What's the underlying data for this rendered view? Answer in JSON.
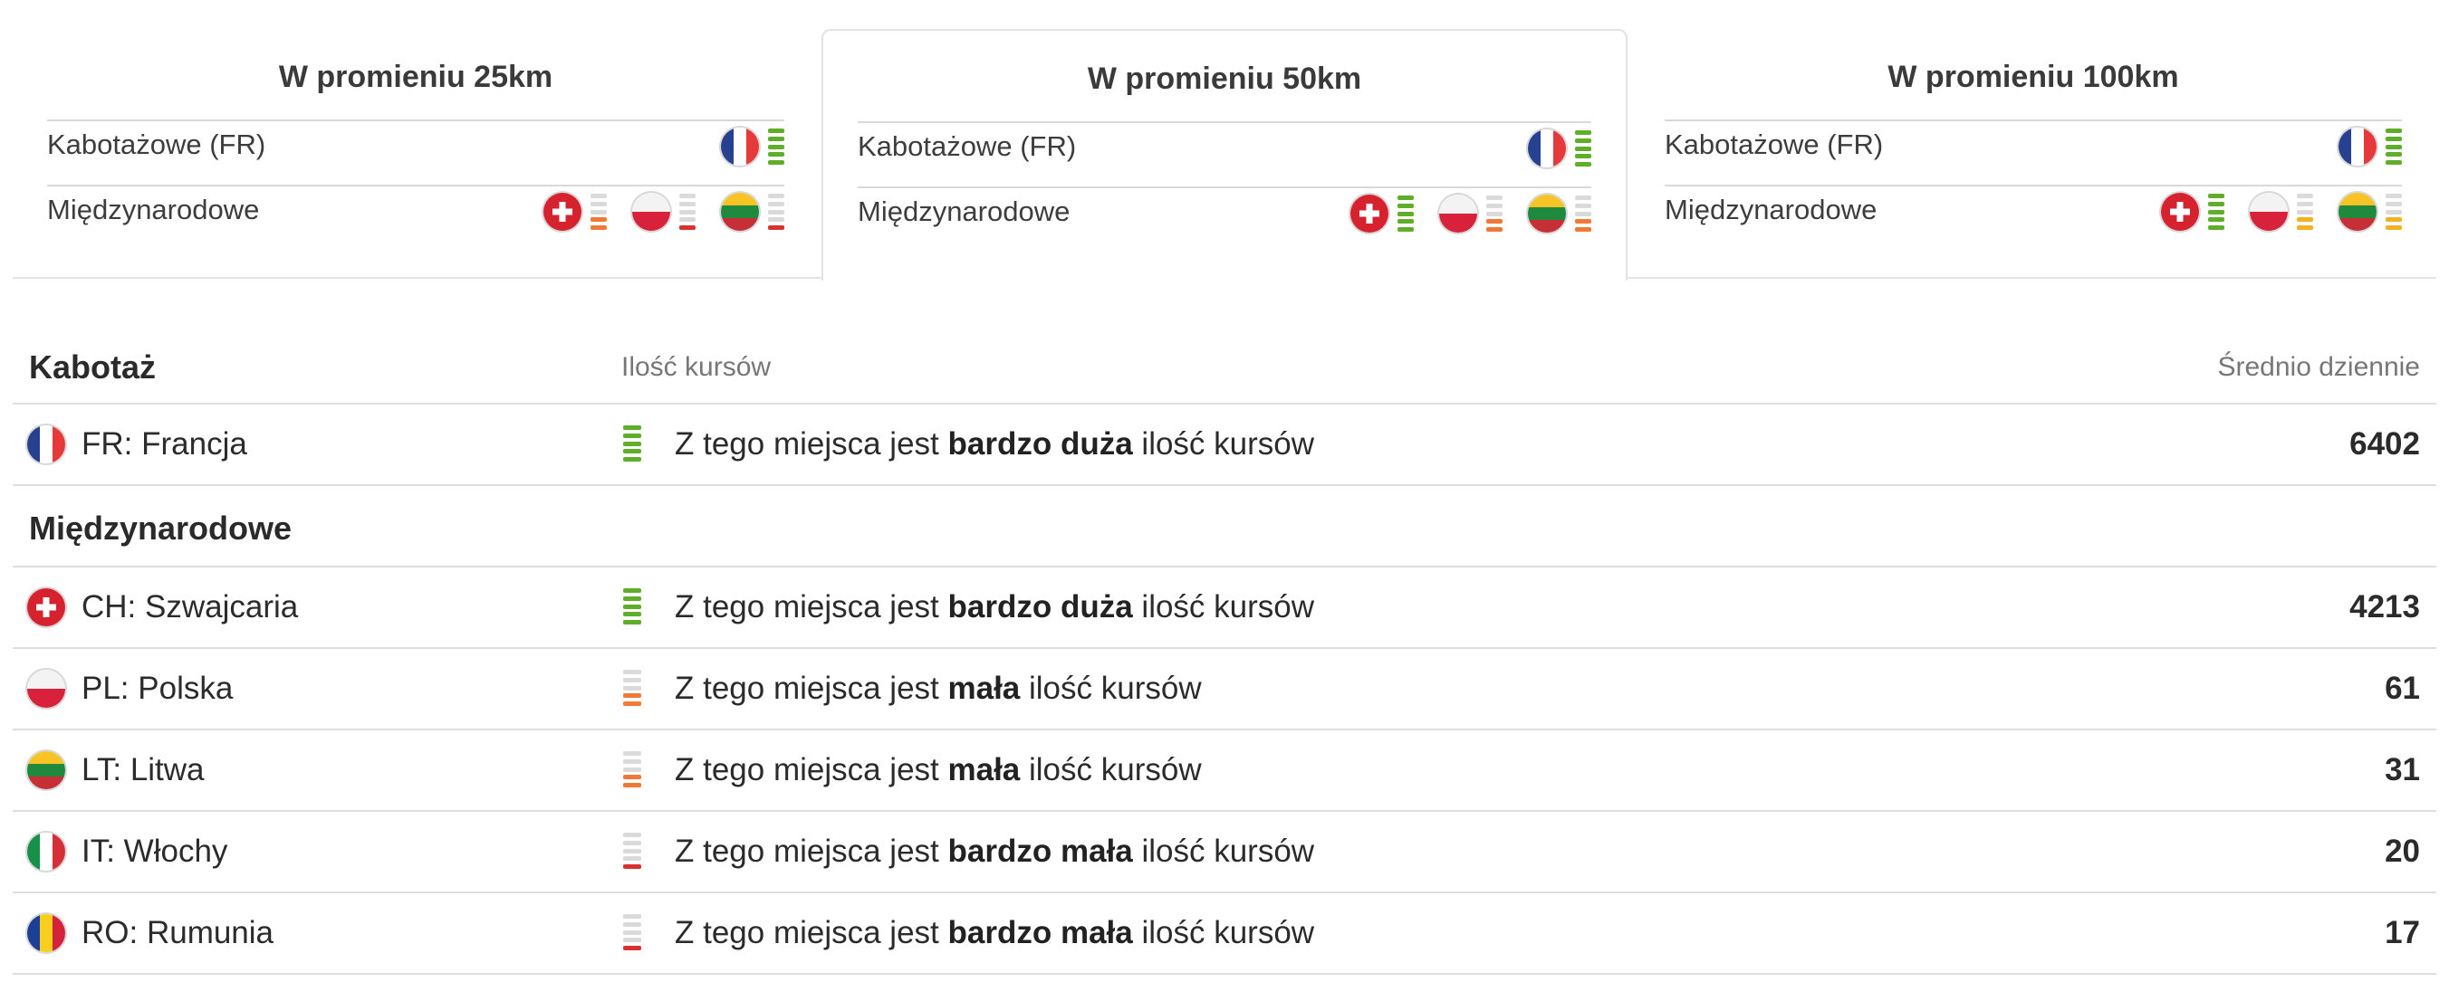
{
  "tabs": [
    {
      "title": "W promieniu 25km",
      "active": false,
      "rows": [
        {
          "label": "Kabotażowe (FR)",
          "flags": [
            {
              "country": "fr",
              "level": "g5"
            }
          ]
        },
        {
          "label": "Międzynarodowe",
          "flags": [
            {
              "country": "ch",
              "level": "o2"
            },
            {
              "country": "pl",
              "level": "r1"
            },
            {
              "country": "lt",
              "level": "r1"
            }
          ]
        }
      ]
    },
    {
      "title": "W promieniu 50km",
      "active": true,
      "rows": [
        {
          "label": "Kabotażowe (FR)",
          "flags": [
            {
              "country": "fr",
              "level": "g5"
            }
          ]
        },
        {
          "label": "Międzynarodowe",
          "flags": [
            {
              "country": "ch",
              "level": "g5"
            },
            {
              "country": "pl",
              "level": "o2"
            },
            {
              "country": "lt",
              "level": "o2"
            }
          ]
        }
      ]
    },
    {
      "title": "W promieniu 100km",
      "active": false,
      "rows": [
        {
          "label": "Kabotażowe (FR)",
          "flags": [
            {
              "country": "fr",
              "level": "g5"
            }
          ]
        },
        {
          "label": "Międzynarodowe",
          "flags": [
            {
              "country": "ch",
              "level": "g5"
            },
            {
              "country": "pl",
              "level": "y2"
            },
            {
              "country": "lt",
              "level": "y2"
            }
          ]
        }
      ]
    }
  ],
  "table": {
    "header": {
      "section": "Kabotaż",
      "count_label": "Ilość kursów",
      "avg_label": "Średnio dziennie"
    },
    "cabotage": [
      {
        "flag": "fr",
        "country": "FR: Francja",
        "level": "g5",
        "prefix": "Z tego miejsca jest ",
        "amount": "bardzo duża",
        "suffix": " ilość kursów",
        "avg": "6402"
      }
    ],
    "international_title": "Międzynarodowe",
    "international": [
      {
        "flag": "ch",
        "country": "CH: Szwajcaria",
        "level": "g5",
        "prefix": "Z tego miejsca jest ",
        "amount": "bardzo duża",
        "suffix": " ilość kursów",
        "avg": "4213"
      },
      {
        "flag": "pl",
        "country": "PL: Polska",
        "level": "o2",
        "prefix": "Z tego miejsca jest ",
        "amount": "mała",
        "suffix": " ilość kursów",
        "avg": "61"
      },
      {
        "flag": "lt",
        "country": "LT: Litwa",
        "level": "o2",
        "prefix": "Z tego miejsca jest ",
        "amount": "mała",
        "suffix": " ilość kursów",
        "avg": "31"
      },
      {
        "flag": "it",
        "country": "IT: Włochy",
        "level": "r1",
        "prefix": "Z tego miejsca jest ",
        "amount": "bardzo mała",
        "suffix": " ilość kursów",
        "avg": "20"
      },
      {
        "flag": "ro",
        "country": "RO: Rumunia",
        "level": "r1",
        "prefix": "Z tego miejsca jest ",
        "amount": "bardzo mała",
        "suffix": " ilość kursów",
        "avg": "17"
      }
    ]
  }
}
